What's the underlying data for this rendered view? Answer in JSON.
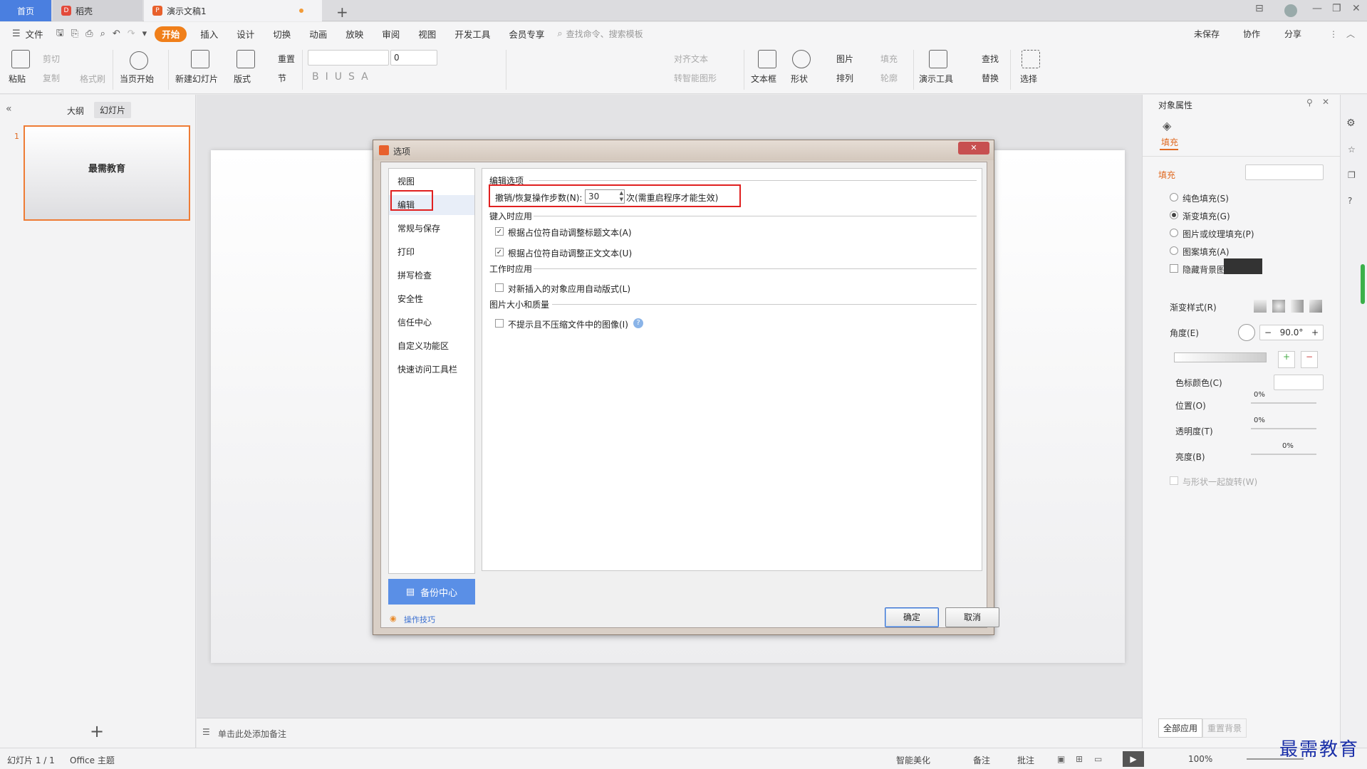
{
  "tabs": {
    "home": "首页",
    "daoke": "稻壳",
    "doc": "演示文稿1"
  },
  "menubar": {
    "file": "文件",
    "items": [
      "开始",
      "插入",
      "设计",
      "切换",
      "动画",
      "放映",
      "审阅",
      "视图",
      "开发工具",
      "会员专享"
    ],
    "search": "查找命令、搜索模板",
    "unsaved": "未保存",
    "collab": "协作",
    "share": "分享"
  },
  "ribbon": {
    "paste": "粘贴",
    "cut": "剪切",
    "copy": "复制",
    "format_painter": "格式刷",
    "from_current": "当页开始",
    "new_slide": "新建幻灯片",
    "layout": "版式",
    "reset": "重置",
    "section": "节",
    "font_size": "0",
    "align_text": "对齐文本",
    "smart_shape": "转智能图形",
    "textbox": "文本框",
    "shape": "形状",
    "picture": "图片",
    "fill": "填充",
    "arrange": "排列",
    "outline": "轮廓",
    "present_tool": "演示工具",
    "find": "查找",
    "replace": "替换",
    "select": "选择"
  },
  "leftpanel": {
    "outline_tab": "大纲",
    "slides_tab": "幻灯片",
    "slide_number": "1",
    "slide_title": "最需教育"
  },
  "notes": {
    "placeholder": "单击此处添加备注"
  },
  "rightpanel": {
    "title": "对象属性",
    "fill_tab": "填充",
    "fill_section": "填充",
    "options": [
      "纯色填充(S)",
      "渐变填充(G)",
      "图片或纹理填充(P)",
      "图案填充(A)"
    ],
    "selected_option": 1,
    "hide_bg": "隐藏背景图形",
    "gradient_style": "渐变样式(R)",
    "angle_label": "角度(E)",
    "angle_value": "90.0°",
    "stop_color": "色标颜色(C)",
    "position": "位置(O)",
    "position_value": "0%",
    "transparency": "透明度(T)",
    "transparency_value": "0%",
    "brightness": "亮度(B)",
    "brightness_value": "0%",
    "rotate_with_shape": "与形状一起旋转(W)",
    "apply_all": "全部应用",
    "reset_bg": "重置背景"
  },
  "statusbar": {
    "slide_info": "幻灯片 1 / 1",
    "theme": "Office 主题",
    "beautify": "智能美化",
    "notes": "备注",
    "comments": "批注",
    "zoom": "100%"
  },
  "dialog": {
    "title": "选项",
    "nav": [
      "视图",
      "编辑",
      "常规与保存",
      "打印",
      "拼写检查",
      "安全性",
      "信任中心",
      "自定义功能区",
      "快速访问工具栏"
    ],
    "selected_nav": 1,
    "backup": "备份中心",
    "tips": "操作技巧",
    "ok": "确定",
    "cancel": "取消",
    "group_edit": "编辑选项",
    "undo_label": "撤销/恢复操作步数(N):",
    "undo_value": "30",
    "undo_note": "次(需重启程序才能生效)",
    "group_typing": "键入时应用",
    "opt_title_autofit": "根据占位符自动调整标题文本(A)",
    "opt_body_autofit": "根据占位符自动调整正文文本(U)",
    "group_working": "工作时应用",
    "opt_autolayout": "对新插入的对象应用自动版式(L)",
    "group_image": "图片大小和质量",
    "opt_no_compress": "不提示且不压缩文件中的图像(I)",
    "checks": {
      "title_autofit": true,
      "body_autofit": true,
      "autolayout": false,
      "no_compress": false
    }
  },
  "watermark": "最需教育",
  "colors": {
    "accent": "#f07f1a",
    "home_tab": "#4a7fe0",
    "highlight": "#e02020",
    "backup_btn": "#5a8fe6"
  }
}
